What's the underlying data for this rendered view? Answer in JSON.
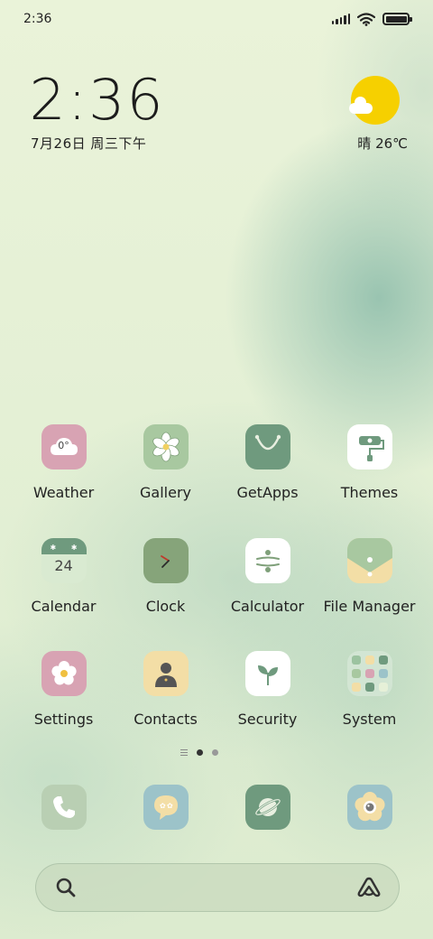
{
  "status_bar": {
    "time": "2:36"
  },
  "clock_widget": {
    "time": "2:36",
    "date": "7月26日 周三下午"
  },
  "weather_widget": {
    "text": "晴 26℃"
  },
  "weather_icon": {
    "temp": "0°"
  },
  "calendar_icon": {
    "day": "24"
  },
  "apps": {
    "weather": "Weather",
    "gallery": "Gallery",
    "getapps": "GetApps",
    "themes": "Themes",
    "calendar": "Calendar",
    "clock": "Clock",
    "calculator": "Calculator",
    "file_manager": "File Manager",
    "settings": "Settings",
    "contacts": "Contacts",
    "security": "Security",
    "system": "System"
  },
  "colors": {
    "wallpaper": "#e8f2d6",
    "sun": "#f6d000",
    "icon_pink": "#d8a3b3",
    "icon_green": "#a8c8a0",
    "icon_darkgreen": "#6f9a7e",
    "icon_yellow": "#f3dea6",
    "icon_blue": "#9cc3c9"
  }
}
